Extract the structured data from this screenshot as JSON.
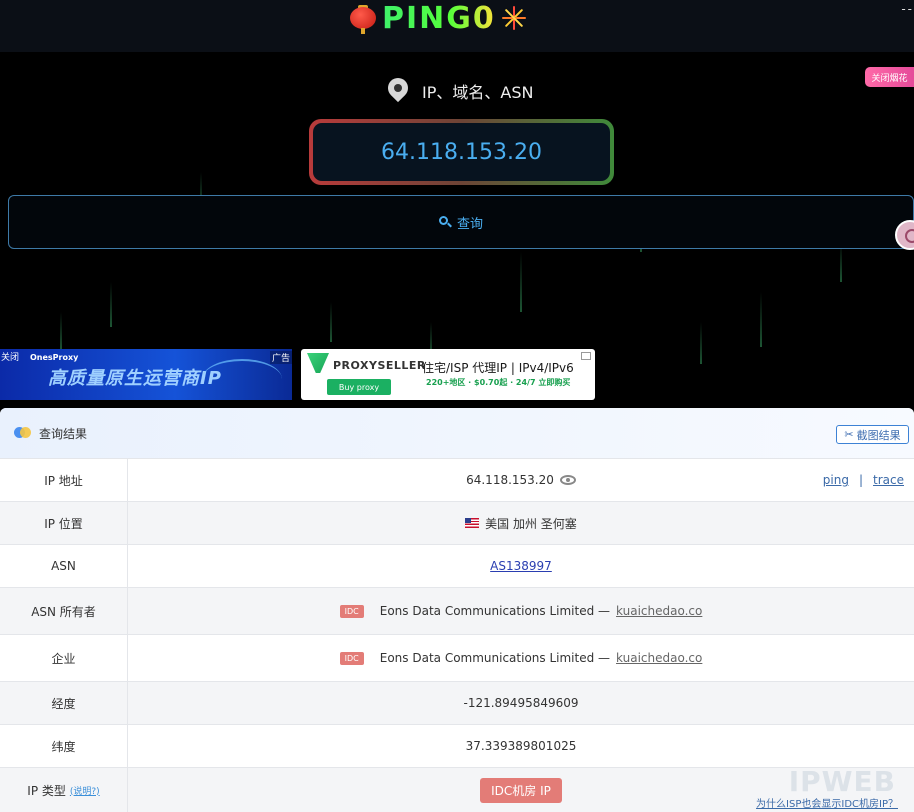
{
  "header": {
    "logo_text": "PING0",
    "top_right": "--"
  },
  "hero": {
    "input_label": "IP、域名、ASN",
    "ip_value": "64.118.153.20",
    "query_button": "查询",
    "close_fireworks": "关闭烟花"
  },
  "ads": {
    "ad1": {
      "close": "关闭",
      "brand": "OnesProxy",
      "tag": "广告",
      "headline": "高质量原生运营商IP"
    },
    "ad2": {
      "brand": "PROXYSELLER",
      "buy": "Buy proxy",
      "main": "住宅/ISP 代理IP | IPv4/IPv6",
      "sub": "220+地区 · $0.70起 · 24/7 立即购买"
    }
  },
  "results": {
    "title": "查询结果",
    "screenshot_button": "截图结果",
    "ping_link": "ping",
    "trace_link": "trace",
    "separator": "|",
    "rows": {
      "ip": {
        "key": "IP 地址",
        "value": "64.118.153.20"
      },
      "location": {
        "key": "IP 位置",
        "value": "美国 加州 圣何塞"
      },
      "asn": {
        "key": "ASN",
        "value": "AS138997"
      },
      "asn_owner": {
        "key": "ASN 所有者",
        "badge": "IDC",
        "name": "Eons Data Communications Limited —",
        "link": "kuaichedao.co"
      },
      "company": {
        "key": "企业",
        "badge": "IDC",
        "name": "Eons Data Communications Limited —",
        "link": "kuaichedao.co"
      },
      "longitude": {
        "key": "经度",
        "value": "-121.89495849609"
      },
      "latitude": {
        "key": "纬度",
        "value": "37.339389801025"
      },
      "ip_type": {
        "key": "IP 类型",
        "explain": "(说明?)",
        "value": "IDC机房 IP",
        "note": "为什么ISP也会显示IDC机房IP？"
      }
    },
    "watermark": "IPWEB"
  }
}
